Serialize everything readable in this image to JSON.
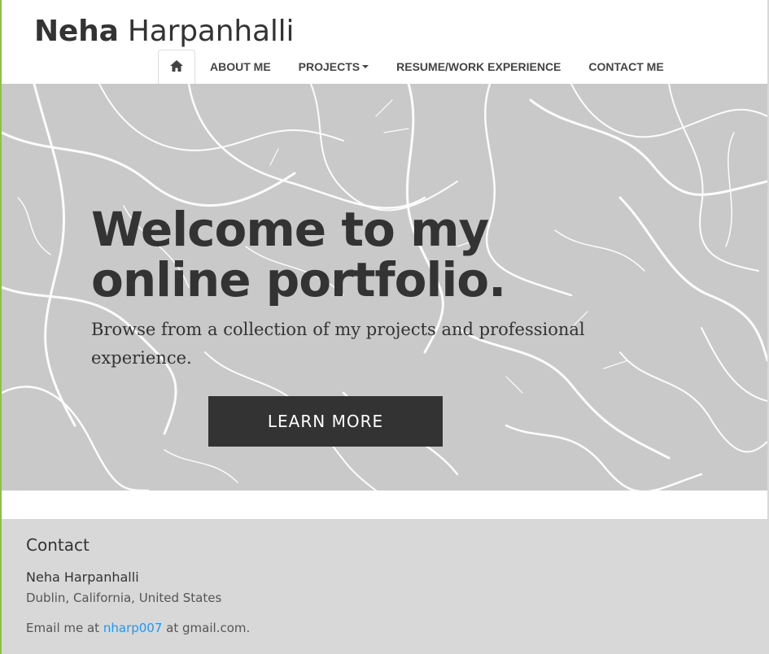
{
  "brand": {
    "first": "Neha",
    "last": "Harpanhalli"
  },
  "nav": {
    "home_icon": "home-icon",
    "items": [
      {
        "label": "ABOUT ME"
      },
      {
        "label": "PROJECTS"
      },
      {
        "label": "RESUME/WORK EXPERIENCE"
      },
      {
        "label": "CONTACT ME"
      }
    ]
  },
  "hero": {
    "title": "Welcome to my online portfolio.",
    "subtitle": "Browse from a collection of my projects and professional experience.",
    "button": "LEARN MORE"
  },
  "footer": {
    "heading": "Contact",
    "name": "Neha Harpanhalli",
    "location": "Dublin, California, United States",
    "email_prefix": "Email me at",
    "email_user": "nharp007",
    "email_suffix": "at gmail.com."
  },
  "colors": {
    "hero_bg": "#c9c9c9",
    "button_bg": "#333333",
    "footer_bg": "#d8d8d8",
    "link": "#2196f3"
  }
}
